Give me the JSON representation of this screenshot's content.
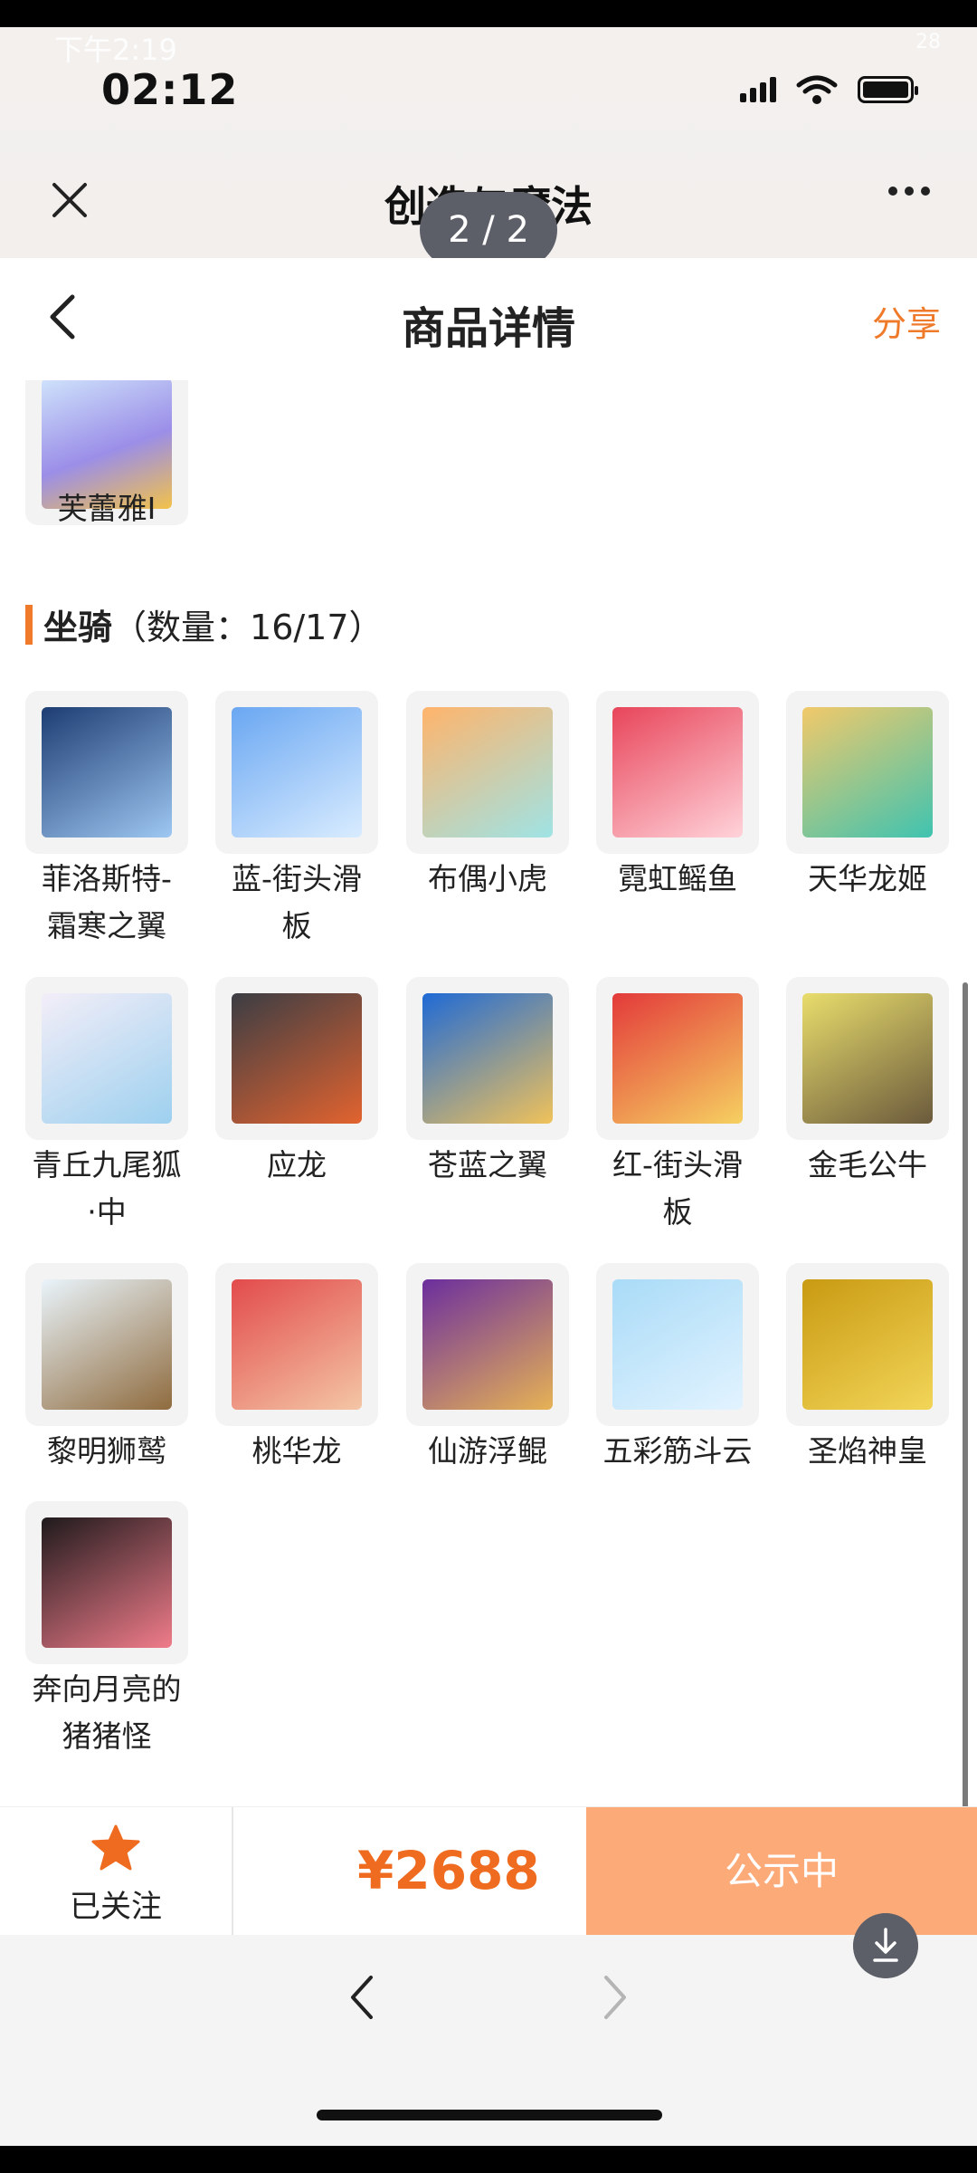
{
  "status_bar": {
    "ghost_time": "下午2:19",
    "ghost_battery": "28",
    "clock": "02:12"
  },
  "miniapp": {
    "title": "创造与魔法",
    "page_indicator": "2 / 2"
  },
  "navbar": {
    "title": "商品详情",
    "share_label": "分享"
  },
  "partial_item": {
    "name": "芙蕾雅I"
  },
  "section": {
    "title": "坐骑",
    "count_label": "（数量：16/17）"
  },
  "mounts": [
    {
      "name": "菲洛斯特-霜寒之翼",
      "color_a": "#1d3d72",
      "color_b": "#9ec7f2"
    },
    {
      "name": "蓝-街头滑板",
      "color_a": "#6aa7f2",
      "color_b": "#d9ecff"
    },
    {
      "name": "布偶小虎",
      "color_a": "#ffb46b",
      "color_b": "#9fe3e5"
    },
    {
      "name": "霓虹鳐鱼",
      "color_a": "#e8455a",
      "color_b": "#ffd3da"
    },
    {
      "name": "天华龙姬",
      "color_a": "#f2c96a",
      "color_b": "#3fc3b0"
    },
    {
      "name": "青丘九尾狐·中",
      "color_a": "#f3eef8",
      "color_b": "#9dd0ef"
    },
    {
      "name": "应龙",
      "color_a": "#3b3d44",
      "color_b": "#e2632f"
    },
    {
      "name": "苍蓝之翼",
      "color_a": "#1f6ad6",
      "color_b": "#f0c25a"
    },
    {
      "name": "红-街头滑板",
      "color_a": "#e33a3a",
      "color_b": "#f6d061"
    },
    {
      "name": "金毛公牛",
      "color_a": "#e8dd6c",
      "color_b": "#6b5a3c"
    },
    {
      "name": "黎明狮鹫",
      "color_a": "#e9f4fb",
      "color_b": "#8f6b3e"
    },
    {
      "name": "桃华龙",
      "color_a": "#e24b4b",
      "color_b": "#f4c6a6"
    },
    {
      "name": "仙游浮鲲",
      "color_a": "#6b2e9e",
      "color_b": "#e6b255"
    },
    {
      "name": "五彩筋斗云",
      "color_a": "#a9dbf7",
      "color_b": "#e2f3ff"
    },
    {
      "name": "圣焰神皇",
      "color_a": "#c99a12",
      "color_b": "#f2d558"
    },
    {
      "name": "奔向月亮的猪猪怪",
      "color_a": "#1f1a1c",
      "color_b": "#f07c8a"
    }
  ],
  "mount_label_lines": [
    [
      "菲洛斯特-",
      "霜寒之翼"
    ],
    [
      "蓝-街头滑",
      "板"
    ],
    [
      "布偶小虎"
    ],
    [
      "霓虹鳐鱼"
    ],
    [
      "天华龙姬"
    ],
    [
      "青丘九尾狐",
      "·中"
    ],
    [
      "应龙"
    ],
    [
      "苍蓝之翼"
    ],
    [
      "红-街头滑",
      "板"
    ],
    [
      "金毛公牛"
    ],
    [
      "黎明狮鹫"
    ],
    [
      "桃华龙"
    ],
    [
      "仙游浮鲲"
    ],
    [
      "五彩筋斗云"
    ],
    [
      "圣焰神皇"
    ],
    [
      "奔向月亮的",
      "猪猪怪"
    ]
  ],
  "bottom_bar": {
    "follow_label": "已关注",
    "price": "¥2688",
    "cta_label": "公示中"
  },
  "colors": {
    "accent": "#ef7a2a",
    "price": "#ef6b1f",
    "cta_bg": "#fdaa79"
  }
}
